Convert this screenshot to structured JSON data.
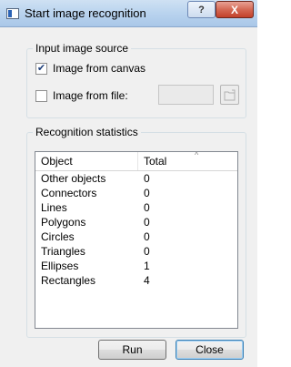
{
  "window": {
    "title": "Start image recognition",
    "help_label": "?",
    "close_label": "X"
  },
  "source_group": {
    "legend": "Input image source",
    "from_canvas": {
      "label": "Image from canvas",
      "checked": true
    },
    "from_file": {
      "label": "Image from file:",
      "checked": false
    },
    "file_path": {
      "value": "",
      "placeholder": ""
    }
  },
  "stats_group": {
    "legend": "Recognition statistics",
    "columns": [
      "Object",
      "Total"
    ],
    "rows": [
      {
        "object": "Other objects",
        "total": "0"
      },
      {
        "object": "Connectors",
        "total": "0"
      },
      {
        "object": "Lines",
        "total": "0"
      },
      {
        "object": "Polygons",
        "total": "0"
      },
      {
        "object": "Circles",
        "total": "0"
      },
      {
        "object": "Triangles",
        "total": "0"
      },
      {
        "object": "Ellipses",
        "total": "1"
      },
      {
        "object": "Rectangles",
        "total": "4"
      }
    ]
  },
  "buttons": {
    "run": "Run",
    "close": "Close"
  }
}
